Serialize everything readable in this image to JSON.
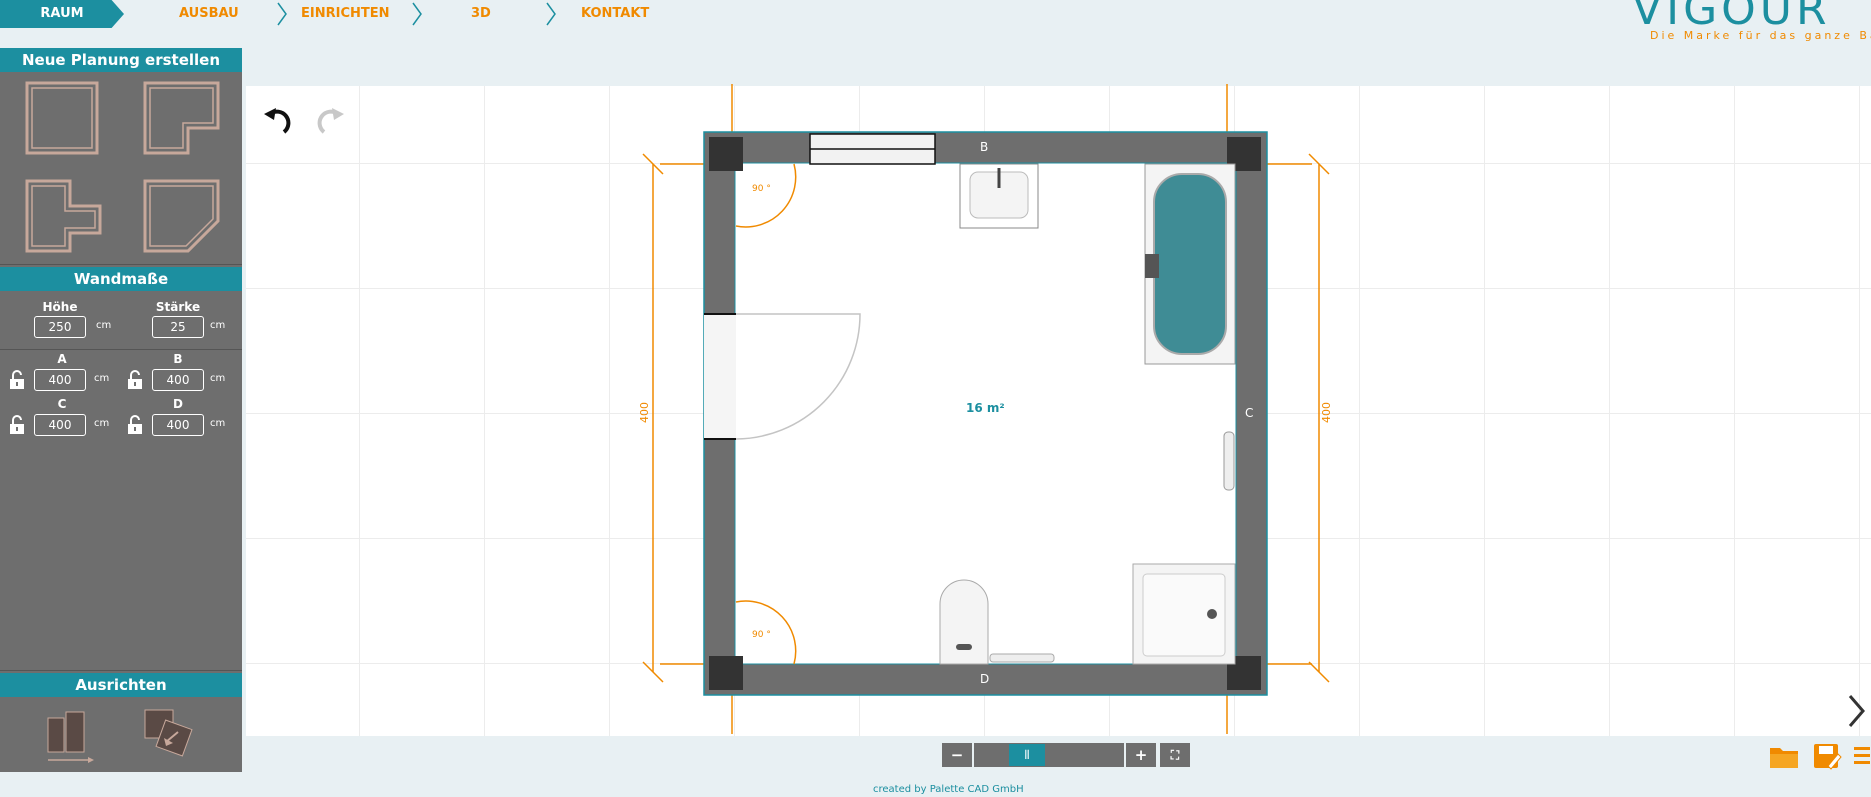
{
  "nav": {
    "active": "RAUM",
    "items": [
      "AUSBAU",
      "EINRICHTEN",
      "3D",
      "KONTAKT"
    ]
  },
  "brand": {
    "logo_text": "VIGOUR",
    "tagline": "Die Marke für das ganze Bad",
    "accent": "#1c8fa0",
    "orange": "#f08a00"
  },
  "sidebar": {
    "new_plan_title": "Neue Planung erstellen",
    "shapes": [
      "rectangle-room-icon",
      "l-shape-room-icon",
      "t-shape-room-icon",
      "angled-room-icon"
    ],
    "wall_title": "Wandmaße",
    "height_label": "Höhe",
    "height_value": "250",
    "thickness_label": "Stärke",
    "thickness_value": "25",
    "unit": "cm",
    "walls": [
      {
        "label": "A",
        "value": "400"
      },
      {
        "label": "B",
        "value": "400"
      },
      {
        "label": "C",
        "value": "400"
      },
      {
        "label": "D",
        "value": "400"
      }
    ],
    "align_title": "Ausrichten"
  },
  "plan": {
    "area": "16 m²",
    "wall_b": "B",
    "wall_c": "C",
    "wall_d": "D",
    "angle_top": "90 °",
    "angle_bottom": "90 °",
    "dim_left": "400",
    "dim_right": "400"
  },
  "footer": {
    "credit": "created by Palette CAD GmbH"
  }
}
